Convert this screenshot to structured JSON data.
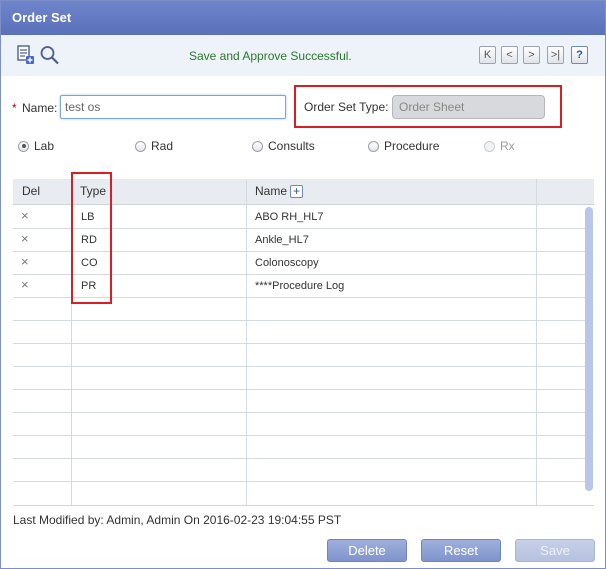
{
  "window": {
    "title": "Order Set"
  },
  "toolbar": {
    "status": "Save and Approve Successful.",
    "nav": {
      "first": "K",
      "prev": "<",
      "next": ">",
      "last": ">|",
      "help": "?"
    },
    "icons": [
      "document-add-icon",
      "search-icon"
    ]
  },
  "form": {
    "name_label": "Name:",
    "required_mark": "*",
    "name_value": "test os",
    "order_set_type_label": "Order Set Type:",
    "order_set_type_value": "Order Sheet"
  },
  "categories": [
    {
      "label": "Lab",
      "selected": true,
      "disabled": false
    },
    {
      "label": "Rad",
      "selected": false,
      "disabled": false
    },
    {
      "label": "Consults",
      "selected": false,
      "disabled": false
    },
    {
      "label": "Procedure",
      "selected": false,
      "disabled": false
    },
    {
      "label": "Rx",
      "selected": false,
      "disabled": true
    }
  ],
  "table": {
    "columns": {
      "del": "Del",
      "type": "Type",
      "name": "Name"
    },
    "rows": [
      {
        "del": "×",
        "type": "LB",
        "name": "ABO RH_HL7"
      },
      {
        "del": "×",
        "type": "RD",
        "name": "Ankle_HL7"
      },
      {
        "del": "×",
        "type": "CO",
        "name": "Colonoscopy"
      },
      {
        "del": "×",
        "type": "PR",
        "name": "****Procedure Log"
      }
    ]
  },
  "footer": {
    "last_modified": "Last Modified by: Admin, Admin On 2016-02-23 19:04:55 PST",
    "buttons": {
      "delete": "Delete",
      "reset": "Reset",
      "save": "Save"
    }
  },
  "colors": {
    "title_bar": "#5a70b9",
    "status_text": "#2a7a2a",
    "highlight_box": "#d81f26"
  }
}
